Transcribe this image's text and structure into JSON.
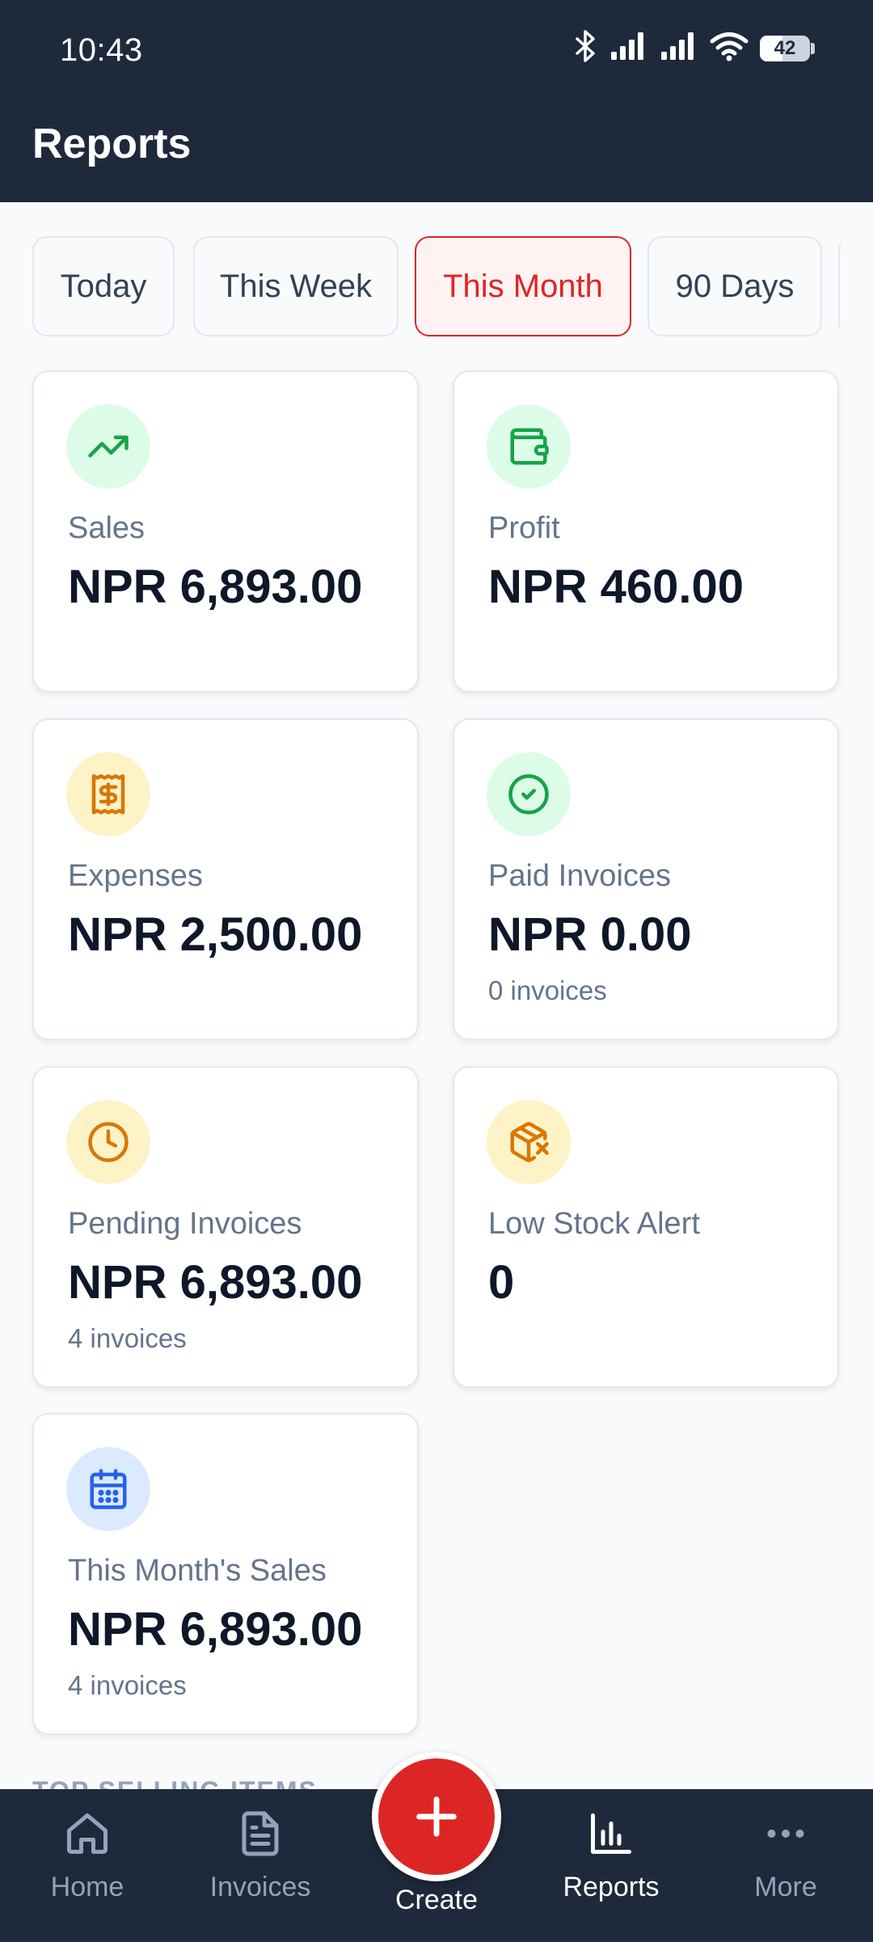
{
  "status_bar": {
    "time": "10:43",
    "battery": "42"
  },
  "header": {
    "title": "Reports"
  },
  "filters": [
    {
      "label": "Today",
      "active": false
    },
    {
      "label": "This Week",
      "active": false
    },
    {
      "label": "This Month",
      "active": true
    },
    {
      "label": "90 Days",
      "active": false
    }
  ],
  "cards": [
    {
      "label": "Sales",
      "value": "NPR 6,893.00",
      "sub": "",
      "icon": "trending-up-icon",
      "icon_color": "#16a34a",
      "icon_bg": "#dcfce7"
    },
    {
      "label": "Profit",
      "value": "NPR 460.00",
      "sub": "",
      "icon": "wallet-icon",
      "icon_color": "#16a34a",
      "icon_bg": "#dcfce7"
    },
    {
      "label": "Expenses",
      "value": "NPR 2,500.00",
      "sub": "",
      "icon": "receipt-icon",
      "icon_color": "#d97706",
      "icon_bg": "#fef3c7"
    },
    {
      "label": "Paid Invoices",
      "value": "NPR 0.00",
      "sub": "0 invoices",
      "icon": "check-circle-icon",
      "icon_color": "#16a34a",
      "icon_bg": "#dcfce7"
    },
    {
      "label": "Pending Invoices",
      "value": "NPR 6,893.00",
      "sub": "4 invoices",
      "icon": "clock-icon",
      "icon_color": "#d97706",
      "icon_bg": "#fef3c7"
    },
    {
      "label": "Low Stock Alert",
      "value": "0",
      "sub": "",
      "icon": "package-x-icon",
      "icon_color": "#d97706",
      "icon_bg": "#fef3c7"
    },
    {
      "label": "This Month's Sales",
      "value": "NPR 6,893.00",
      "sub": "4 invoices",
      "icon": "calendar-icon",
      "icon_color": "#2563eb",
      "icon_bg": "#dbeafe"
    }
  ],
  "section_peek": "TOP SELLING ITEMS",
  "bottom_nav": {
    "items": [
      {
        "label": "Home",
        "icon": "home-icon",
        "active": false
      },
      {
        "label": "Invoices",
        "icon": "file-text-icon",
        "active": false
      },
      {
        "label": "Reports",
        "icon": "bar-chart-icon",
        "active": true
      },
      {
        "label": "More",
        "icon": "more-horizontal-icon",
        "active": false
      }
    ],
    "create_label": "Create"
  },
  "colors": {
    "accent": "#dc2626",
    "header_bg": "#1e293b",
    "page_bg": "#f8fafc"
  }
}
